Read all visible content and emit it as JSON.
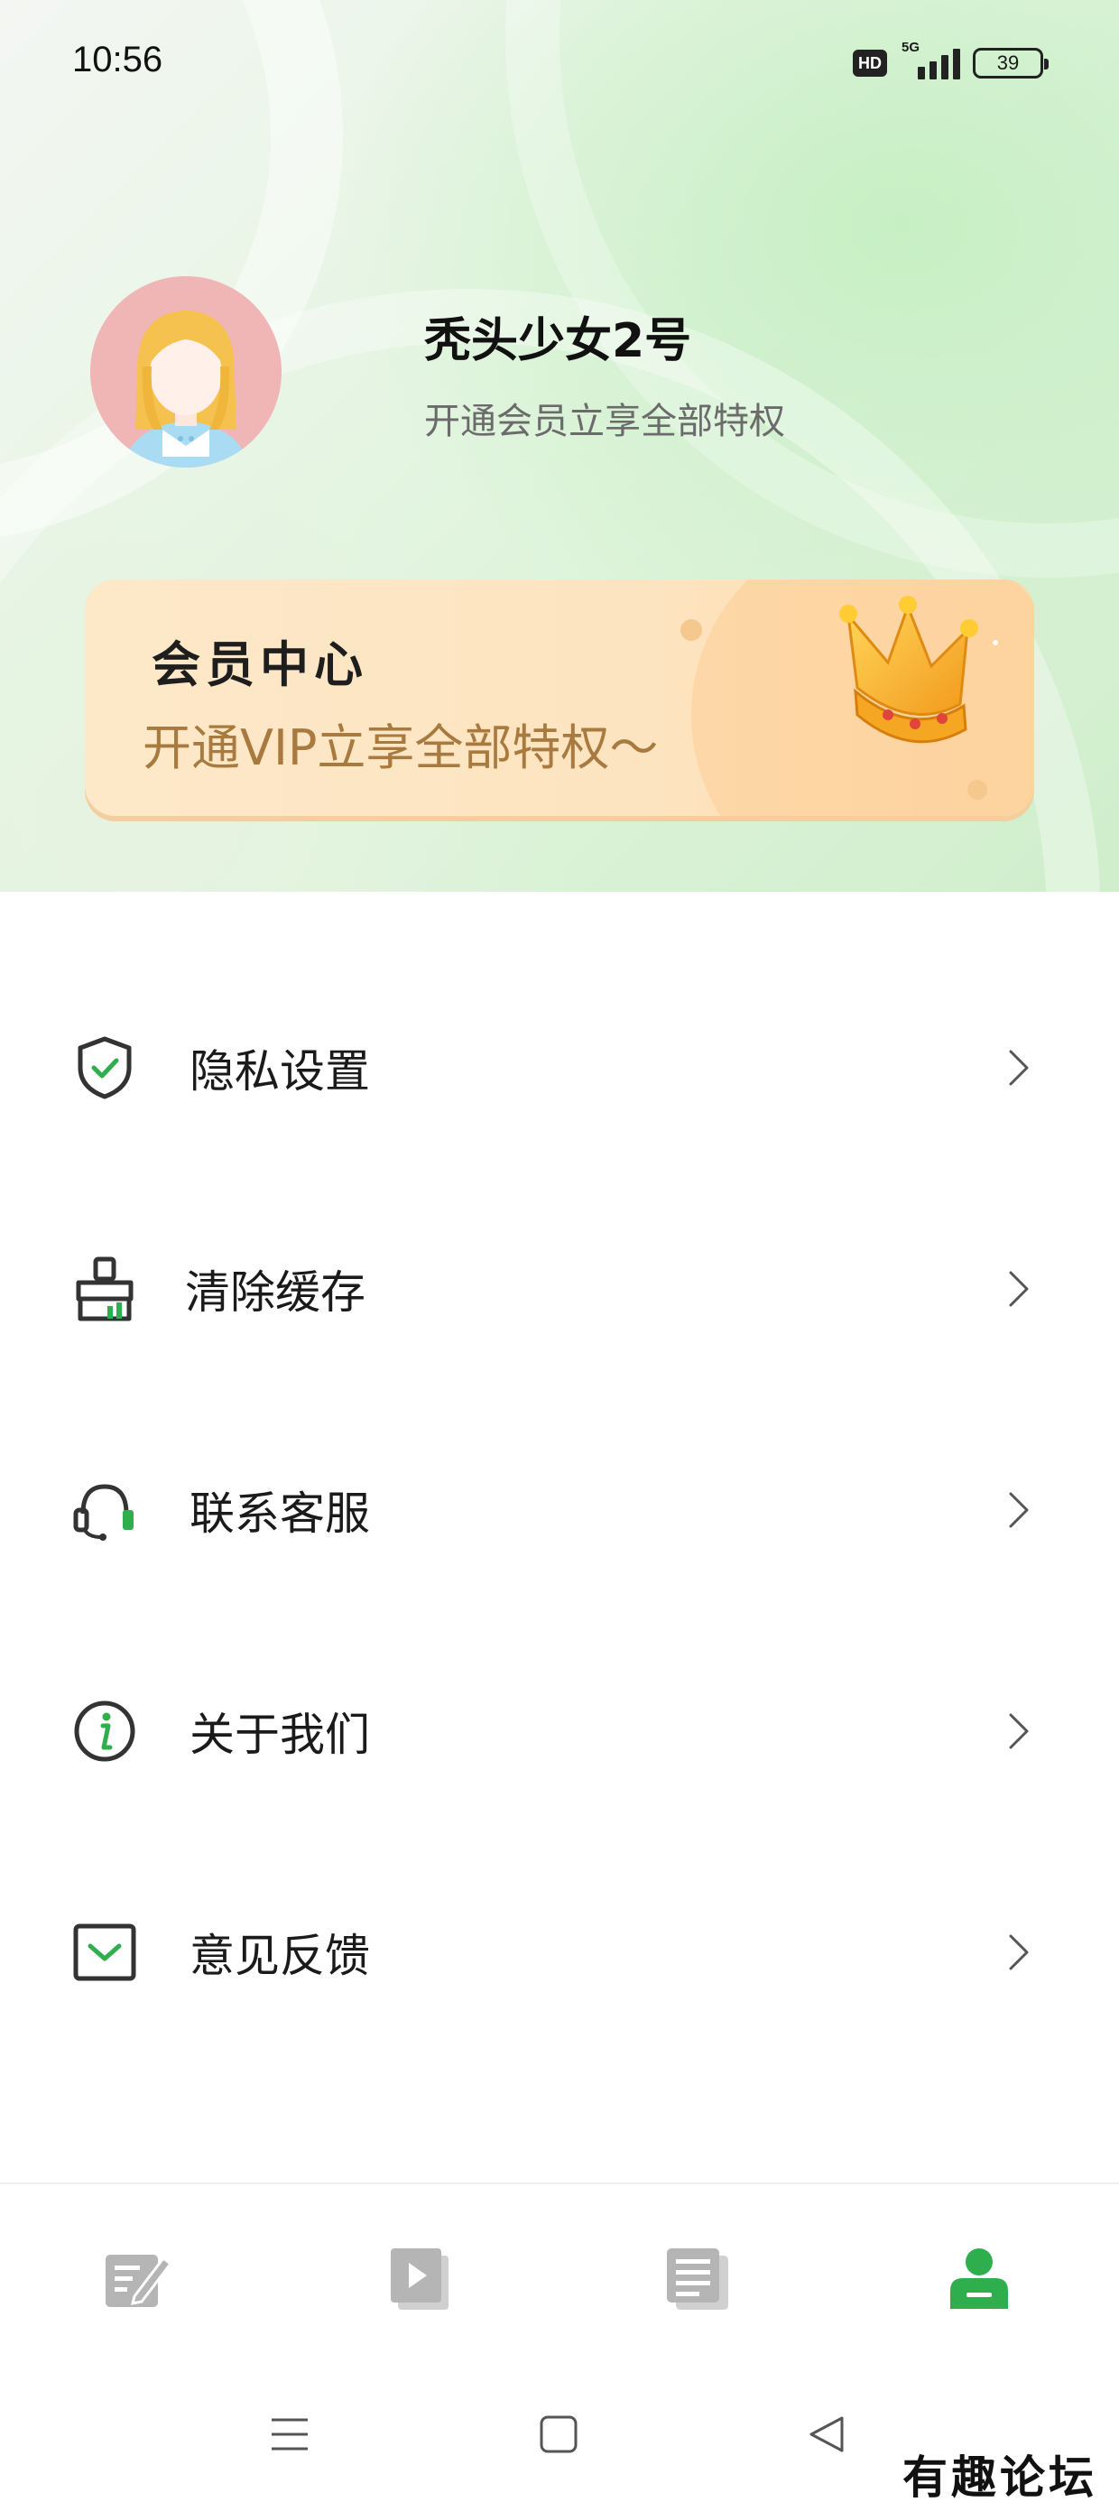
{
  "status_bar": {
    "time": "10:56",
    "hd_label": "HD",
    "network_label": "5G",
    "battery": "39"
  },
  "profile": {
    "avatar_icon": "girl-avatar-icon",
    "username": "秃头少女2号",
    "subtitle": "开通会员立享全部特权"
  },
  "vip_card": {
    "title": "会员中心",
    "subtitle": "开通VIP立享全部特权～",
    "icon": "crown-icon",
    "accent_color": "#a97a3f"
  },
  "menu": {
    "items": [
      {
        "label": "隐私设置",
        "icon": "shield-check-icon"
      },
      {
        "label": "清除缓存",
        "icon": "broom-icon"
      },
      {
        "label": "联系客服",
        "icon": "headset-icon"
      },
      {
        "label": "关于我们",
        "icon": "info-icon"
      },
      {
        "label": "意见反馈",
        "icon": "feedback-mail-icon"
      }
    ]
  },
  "tab_bar": {
    "items": [
      {
        "icon": "edit-note-icon",
        "active": false
      },
      {
        "icon": "video-play-icon",
        "active": false
      },
      {
        "icon": "document-icon",
        "active": false
      },
      {
        "icon": "profile-icon",
        "active": true
      }
    ],
    "active_color": "#2fae4e",
    "inactive_color": "#b5b5b5"
  },
  "watermark": "有趣论坛"
}
